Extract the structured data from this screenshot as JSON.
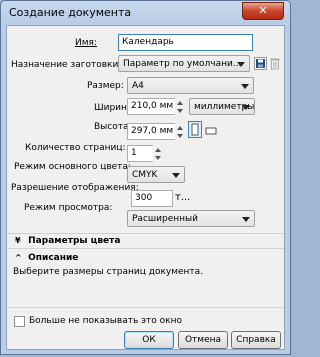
{
  "window": {
    "title": "Создание документа",
    "close_glyph": "✕"
  },
  "form": {
    "name_label": "Имя:",
    "name_value": "Календарь",
    "preset_label": "Назначение заготовки:",
    "preset_value": "Параметр по умолчани...",
    "size_label": "Размер:",
    "size_value": "A4",
    "width_label": "Ширина:",
    "width_value": "210,0 мм",
    "units_value": "миллиметры",
    "height_label": "Высота:",
    "height_value": "297,0 мм",
    "pages_label": "Количество страниц:",
    "pages_value": "1",
    "color_mode_label": "Режим основного цвета:",
    "color_mode_value": "CMYK",
    "resolution_label": "Разрешение отображения:",
    "resolution_value": "300",
    "resolution_unit": "т...",
    "view_mode_label": "Режим просмотра:",
    "view_mode_value": "Расширенный"
  },
  "sections": {
    "color_params": {
      "label": "Параметры цвета",
      "chevron": "¥"
    },
    "description": {
      "label": "Описание",
      "chevron": "^",
      "text": "Выберите размеры страниц документа."
    }
  },
  "footer": {
    "checkbox_label": "Больше не показывать это окно",
    "ok_label": "ОК",
    "cancel_label": "Отмена",
    "help_label": "Справка"
  },
  "colors": {
    "accent": "#3c7fb1",
    "title_bar": "#b9cde6",
    "close_button": "#c9452c"
  },
  "icons": [
    "close-icon",
    "save-preset-icon",
    "delete-preset-icon",
    "portrait-orientation-icon",
    "landscape-orientation-icon",
    "chevron-down-icon",
    "chevron-up-icon"
  ]
}
